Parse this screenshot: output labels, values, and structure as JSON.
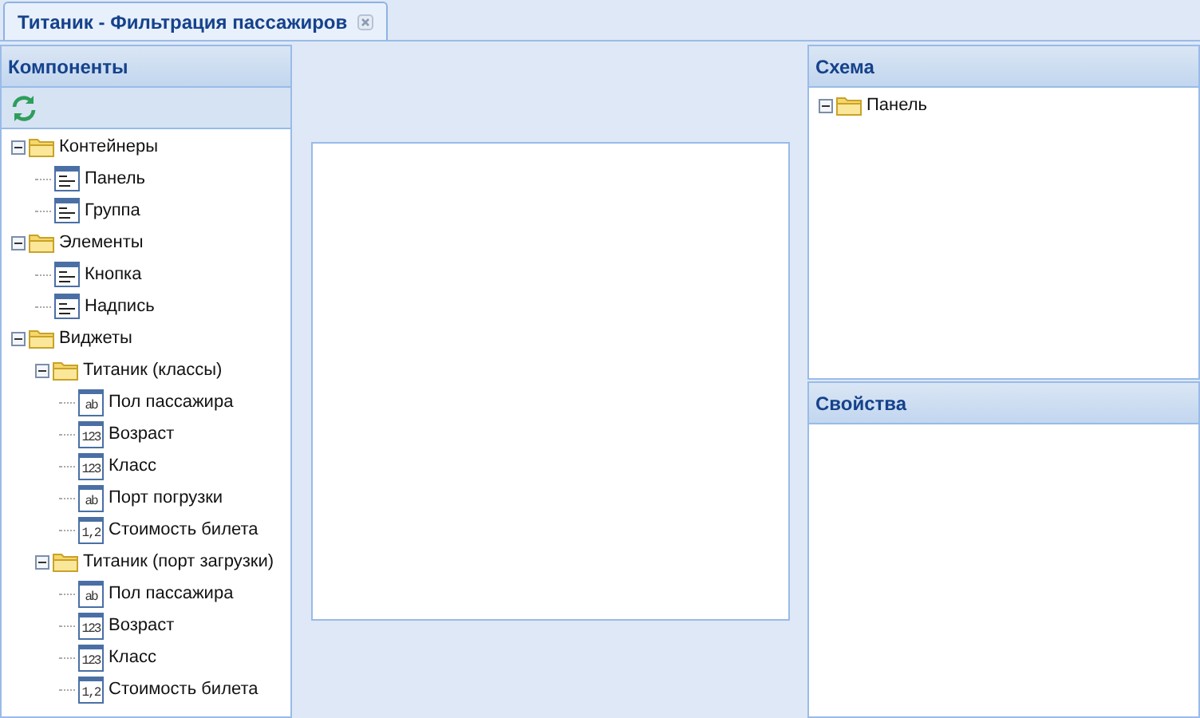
{
  "tab": {
    "title": "Титаник - Фильтрация пассажиров",
    "selected": true
  },
  "components": {
    "title": "Компоненты",
    "tree": [
      {
        "label": "Контейнеры",
        "kind": "folder",
        "expanded": true,
        "children": [
          {
            "label": "Панель",
            "kind": "form"
          },
          {
            "label": "Группа",
            "kind": "form"
          }
        ]
      },
      {
        "label": "Элементы",
        "kind": "folder",
        "expanded": true,
        "children": [
          {
            "label": "Кнопка",
            "kind": "form"
          },
          {
            "label": "Надпись",
            "kind": "form"
          }
        ]
      },
      {
        "label": "Виджеты",
        "kind": "folder",
        "expanded": true,
        "children": [
          {
            "label": "Титаник (классы)",
            "kind": "folder",
            "expanded": true,
            "children": [
              {
                "label": "Пол пассажира",
                "kind": "field",
                "icon_text": "ab"
              },
              {
                "label": "Возраст",
                "kind": "field",
                "icon_text": "123"
              },
              {
                "label": "Класс",
                "kind": "field",
                "icon_text": "123"
              },
              {
                "label": "Порт погрузки",
                "kind": "field",
                "icon_text": "ab"
              },
              {
                "label": "Стоимость билета",
                "kind": "field",
                "icon_text": "1,2"
              }
            ]
          },
          {
            "label": "Титаник (порт загрузки)",
            "kind": "folder",
            "expanded": true,
            "children": [
              {
                "label": "Пол пассажира",
                "kind": "field",
                "icon_text": "ab"
              },
              {
                "label": "Возраст",
                "kind": "field",
                "icon_text": "123"
              },
              {
                "label": "Класс",
                "kind": "field",
                "icon_text": "123"
              },
              {
                "label": "Стоимость билета",
                "kind": "field",
                "icon_text": "1,2"
              }
            ]
          }
        ]
      }
    ]
  },
  "schema": {
    "title": "Схема",
    "tree": [
      {
        "label": "Панель",
        "kind": "folder",
        "expanded": true
      }
    ]
  },
  "properties": {
    "title": "Свойства"
  }
}
